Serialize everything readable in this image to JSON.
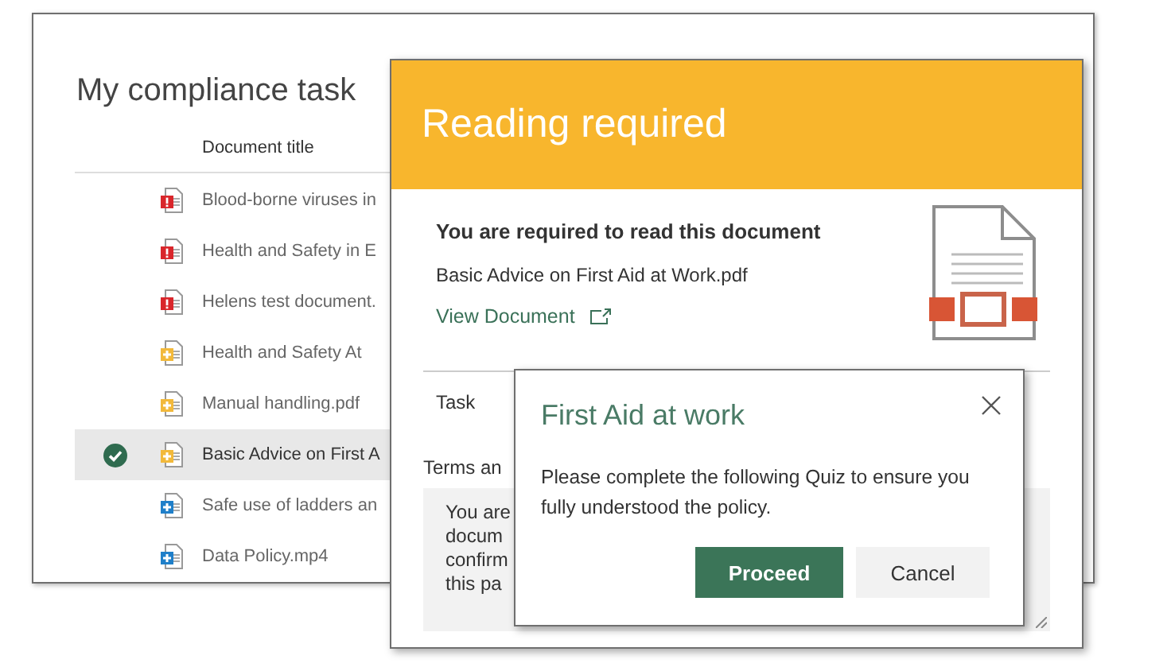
{
  "background_page": {
    "title": "My compliance task",
    "column": "Document title",
    "rows": [
      {
        "title": "Blood-borne viruses in",
        "kind": "overdue",
        "selected": false
      },
      {
        "title": "Health and Safety in E",
        "kind": "overdue",
        "selected": false
      },
      {
        "title": "Helens test document.",
        "kind": "overdue",
        "selected": false
      },
      {
        "title": "Health and Safety At",
        "kind": "pending",
        "selected": false
      },
      {
        "title": "Manual handling.pdf",
        "kind": "pending",
        "selected": false
      },
      {
        "title": "Basic Advice on First A",
        "kind": "pending",
        "selected": true
      },
      {
        "title": "Safe use of ladders an",
        "kind": "new",
        "selected": false
      },
      {
        "title": "Data Policy.mp4",
        "kind": "new",
        "selected": false
      }
    ]
  },
  "reading_dialog": {
    "title": "Reading required",
    "heading": "You are required to read this document",
    "file_name": "Basic Advice on First Aid at Work.pdf",
    "link": "View Document",
    "task_label": "Task",
    "terms_label": "Terms an",
    "terms_lines": [
      "You are",
      "docum",
      "confirm",
      "this pa"
    ]
  },
  "quiz_dialog": {
    "title": "First Aid at work",
    "message": "Please complete the following Quiz to ensure you fully understood the policy.",
    "buttons": [
      {
        "label": "Proceed",
        "kind": "primary"
      },
      {
        "label": "Cancel",
        "kind": "secondary"
      }
    ]
  }
}
